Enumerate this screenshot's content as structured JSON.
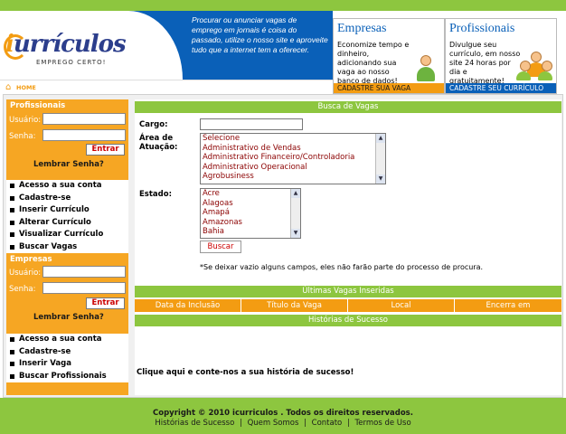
{
  "header": {
    "logo_text": "urrículos",
    "logo_initial": "i",
    "logo_tagline": "EMPREGO CERTO!",
    "intro": "Procurar ou anunciar vagas de emprego em jornais é coisa do passado, utilize o nosso site e aproveite tudo que a internet tem a oferecer.",
    "home_label": "HOME"
  },
  "promos": {
    "empresas": {
      "title": "Empresas",
      "text": "Economize tempo e dinheiro, adicionando sua vaga ao nosso banco de dados!",
      "cta": "CADASTRE SUA VAGA"
    },
    "profissionais": {
      "title": "Profissionais",
      "text": "Divulgue seu currículo, em nosso site 24 horas por dia e gratuitamente!",
      "cta": "CADASTRE SEU CURRÍCULO"
    }
  },
  "sidebar": {
    "profissionais": {
      "heading": "Profissionais",
      "user_label": "Usuário:",
      "pass_label": "Senha:",
      "login_button": "Entrar",
      "remember": "Lembrar Senha?",
      "menu": [
        "Acesso a sua conta",
        "Cadastre-se",
        "Inserir Currículo",
        "Alterar Currículo",
        "Visualizar Currículo",
        "Buscar Vagas"
      ]
    },
    "empresas": {
      "heading": "Empresas",
      "user_label": "Usuário:",
      "pass_label": "Senha:",
      "login_button": "Entrar",
      "remember": "Lembrar Senha?",
      "menu": [
        "Acesso a sua conta",
        "Cadastre-se",
        "Inserir Vaga",
        "Buscar Profissionais"
      ]
    }
  },
  "search": {
    "title": "Busca de Vagas",
    "cargo_label": "Cargo:",
    "area_label_1": "Área de",
    "area_label_2": "Atuação:",
    "area_options": [
      "Selecione",
      "Administrativo de Vendas",
      "Administrativo Financeiro/Controladoria",
      "Administrativo Operacional",
      "Agrobusiness"
    ],
    "estado_label": "Estado:",
    "estado_options": [
      "Acre",
      "Alagoas",
      "Amapá",
      "Amazonas",
      "Bahia"
    ],
    "button": "Buscar",
    "note": "*Se deixar vazio alguns campos, eles não farão parte do processo de procura."
  },
  "latest": {
    "title": "Últimas Vagas Inseridas",
    "columns": [
      "Data da Inclusão",
      "Título da Vaga",
      "Local",
      "Encerra em"
    ]
  },
  "stories": {
    "title": "Histórias de Sucesso",
    "cta": "Clique aqui e conte-nos a sua história de sucesso!"
  },
  "footer": {
    "copyright": "Copyright © 2010 icurriculos . Todos os direitos reservados.",
    "links": [
      "Histórias de Sucesso",
      "Quem Somos",
      "Contato",
      "Termos de Uso"
    ],
    "separator": "|"
  },
  "colors": {
    "green": "#8dc63f",
    "orange": "#f39c12",
    "blue": "#0a60b8"
  }
}
